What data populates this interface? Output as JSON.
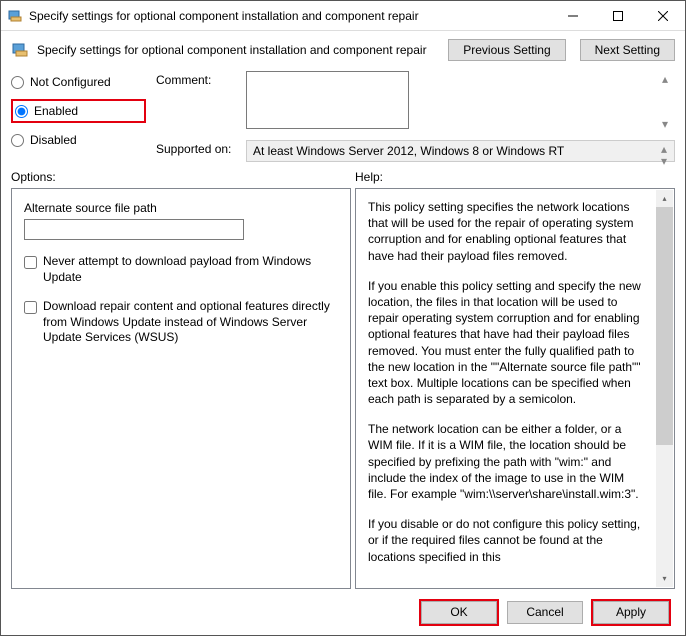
{
  "title": "Specify settings for optional component installation and component repair",
  "header_title": "Specify settings for optional component installation and component repair",
  "nav": {
    "prev": "Previous Setting",
    "next": "Next Setting"
  },
  "radios": {
    "not_configured": "Not Configured",
    "enabled": "Enabled",
    "disabled": "Disabled"
  },
  "labels": {
    "comment": "Comment:",
    "supported_on": "Supported on:",
    "options": "Options:",
    "help": "Help:"
  },
  "supported_text": "At least Windows Server 2012, Windows 8 or Windows RT",
  "options_panel": {
    "alt_source_label": "Alternate source file path",
    "alt_source_value": "",
    "chk1": "Never attempt to download payload from Windows Update",
    "chk2": "Download repair content and optional features directly from Windows Update instead of Windows Server Update Services (WSUS)"
  },
  "help_paragraphs": [
    "This policy setting specifies the network locations that will be used for the repair of operating system corruption and for enabling optional features that have had their payload files removed.",
    "If you enable this policy setting and specify the new location, the files in that location will be used to repair operating system corruption and for enabling optional features that have had their payload files removed. You must enter the fully qualified path to the new location in the \"\"Alternate source file path\"\" text box. Multiple locations can be specified when each path is separated by a semicolon.",
    "The network location can be either a folder, or a WIM file. If it is a WIM file, the location should be specified by prefixing the path with \"wim:\" and include the index of the image to use in the WIM file. For example \"wim:\\\\server\\share\\install.wim:3\".",
    "If you disable or do not configure this policy setting, or if the required files cannot be found at the locations specified in this"
  ],
  "footer": {
    "ok": "OK",
    "cancel": "Cancel",
    "apply": "Apply"
  }
}
